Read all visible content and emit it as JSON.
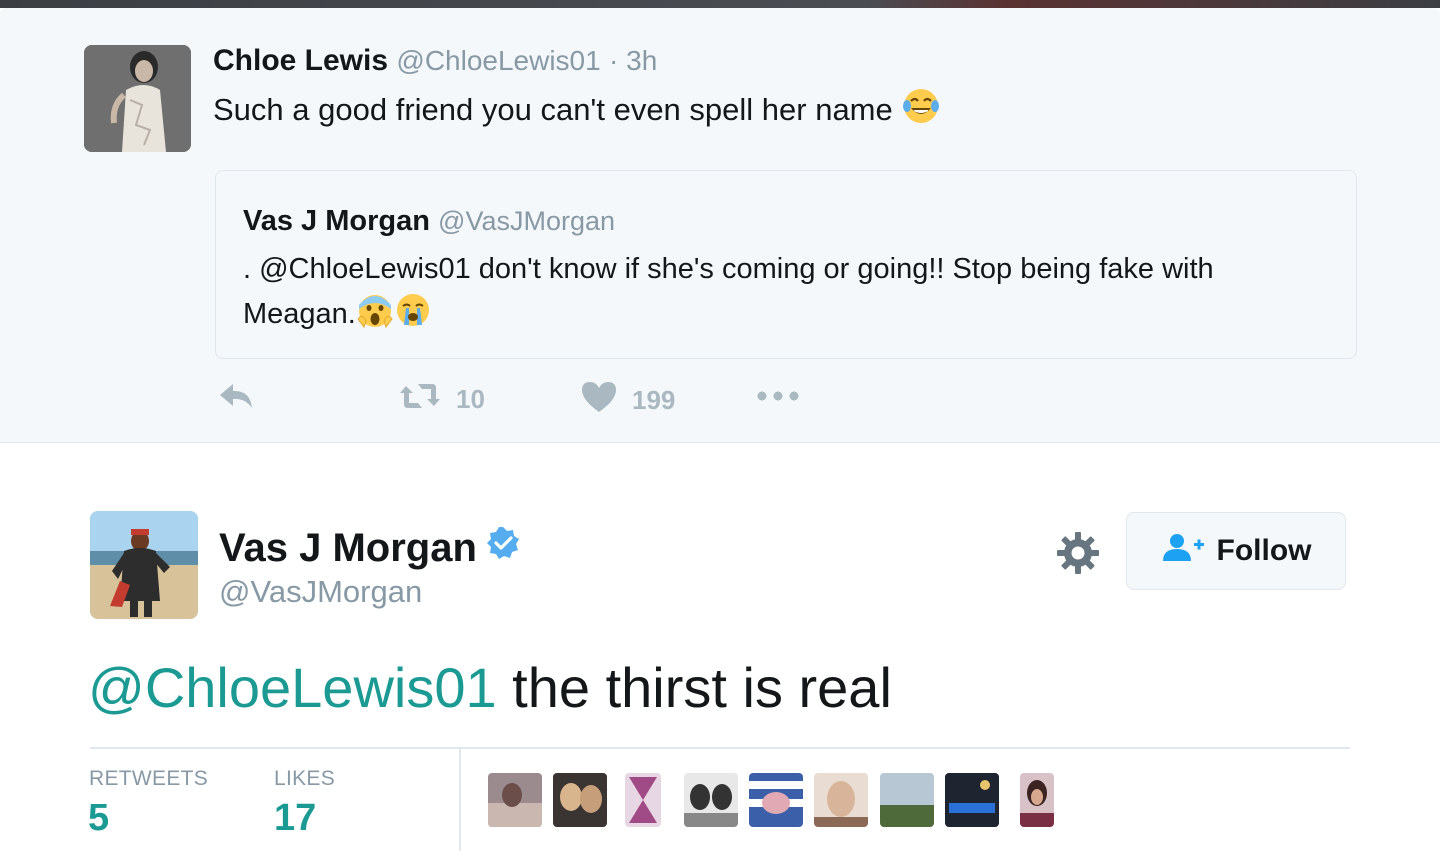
{
  "quoted_tweet": {
    "author_name": "Chloe Lewis",
    "author_handle": "@ChloeLewis01",
    "time": "· 3h",
    "text": "Such a good friend you can't even spell her name",
    "emoji_icon": "face-with-tears-of-joy",
    "embedded": {
      "author_name": "Vas J Morgan",
      "author_handle": "@VasJMorgan",
      "text": ". @ChloeLewis01 don't know if she's coming or going!! Stop being fake with Meagan.",
      "emoji_icons": [
        "face-screaming-in-fear",
        "loudly-crying-face"
      ]
    },
    "actions": {
      "reply_icon": "reply-icon",
      "retweet_icon": "retweet-icon",
      "retweet_count": "10",
      "like_icon": "heart-icon",
      "like_count": "199",
      "more_icon": "more-icon"
    }
  },
  "main_tweet": {
    "author_name": "Vas J Morgan",
    "verified": true,
    "author_handle": "@VasJMorgan",
    "follow_label": "Follow",
    "mention": "@ChloeLewis01",
    "text": " the thirst is real",
    "stats": {
      "retweets_label": "RETWEETS",
      "retweets_value": "5",
      "likes_label": "LIKES",
      "likes_value": "17"
    }
  },
  "colors": {
    "accent": "#1b9a93",
    "verified": "#55acee",
    "follow_icon": "#1da1f2",
    "muted": "#8899a6",
    "action_icon": "#aab8c2"
  }
}
